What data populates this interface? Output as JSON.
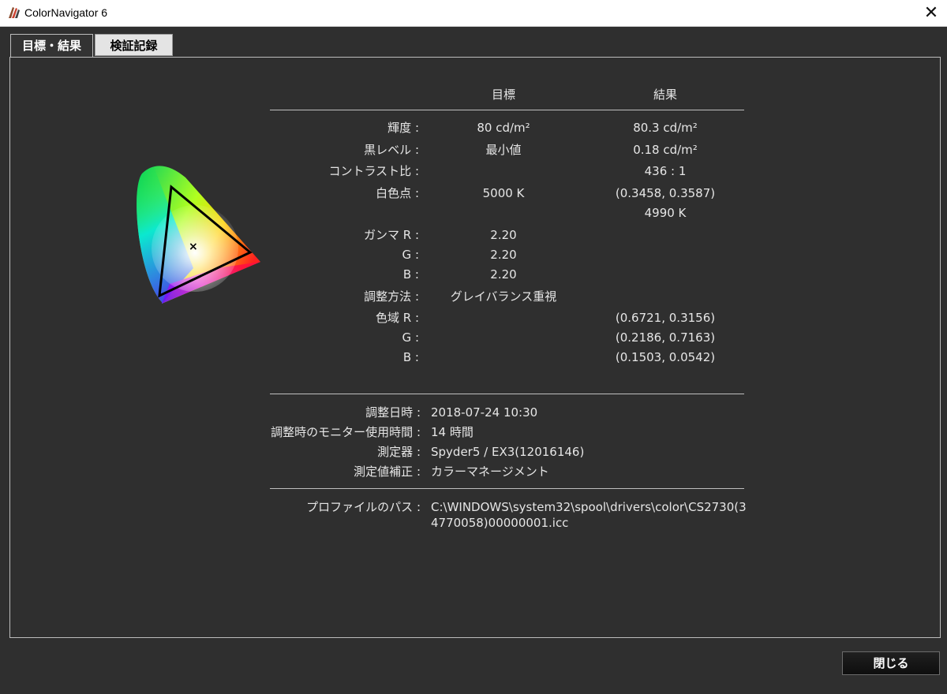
{
  "window": {
    "title": "ColorNavigator 6"
  },
  "tabs": [
    {
      "label": "目標・結果",
      "active": true
    },
    {
      "label": "検証記録",
      "active": false
    }
  ],
  "table": {
    "col_target": "目標",
    "col_result": "結果",
    "rows": [
      {
        "label": "輝度 :",
        "target": "80 cd/m²",
        "result": "80.3 cd/m²"
      },
      {
        "label": "黒レベル :",
        "target": "最小値",
        "result": "0.18 cd/m²"
      },
      {
        "label": "コントラスト比 :",
        "target": "",
        "result": "436 : 1"
      },
      {
        "label": "白色点 :",
        "target": "5000 K",
        "result": "(0.3458, 0.3587)"
      },
      {
        "label": "",
        "target": "",
        "result": "4990 K"
      },
      {
        "label": "ガンマ R :",
        "target": "2.20",
        "result": ""
      },
      {
        "label": "G :",
        "target": "2.20",
        "result": ""
      },
      {
        "label": "B :",
        "target": "2.20",
        "result": ""
      },
      {
        "label": "調整方法 :",
        "target": "グレイバランス重視",
        "result": ""
      },
      {
        "label": "色域 R :",
        "target": "",
        "result": "(0.6721, 0.3156)"
      },
      {
        "label": "G :",
        "target": "",
        "result": "(0.2186, 0.7163)"
      },
      {
        "label": "B :",
        "target": "",
        "result": "(0.1503, 0.0542)"
      }
    ]
  },
  "info": [
    {
      "label": "調整日時 :",
      "value": "2018-07-24 10:30"
    },
    {
      "label": "調整時のモニター使用時間 :",
      "value": "14 時間"
    },
    {
      "label": "測定器 :",
      "value": "Spyder5 / EX3(12016146)"
    },
    {
      "label": "測定値補正 :",
      "value": "カラーマネージメント"
    }
  ],
  "profile": {
    "label": "プロファイルのパス :",
    "value": "C:\\WINDOWS\\system32\\spool\\drivers\\color\\CS2730(34770058)00000001.icc"
  },
  "footer": {
    "close_label": "閉じる"
  }
}
